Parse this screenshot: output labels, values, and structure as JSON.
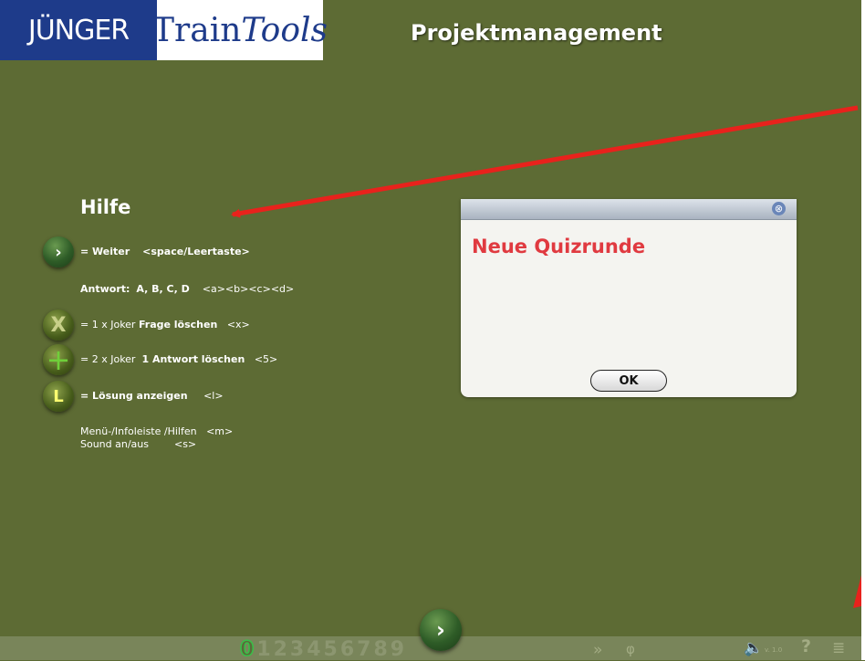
{
  "header": {
    "brand": "JÜNGER",
    "product_train": "Train",
    "product_tools": "Tools",
    "title": "Projektmanagement"
  },
  "help": {
    "title": "Hilfe",
    "next_label": "= Weiter",
    "next_key": "<space/Leertaste>",
    "answer_label": "Antwort:",
    "answer_options": "A, B, C, D",
    "answer_keys": "<a><b><c><d>",
    "joker1_prefix": "= 1 x Joker",
    "joker1_label": "Frage löschen",
    "joker1_key": "<x>",
    "joker2_prefix": "= 2 x Joker",
    "joker2_label": "1 Antwort löschen",
    "joker2_key": "<5>",
    "solution_label": "= Lösung anzeigen",
    "solution_key": "<l>",
    "menu_label": "Menü-/Infoleiste /Hilfen",
    "menu_key": "<m>",
    "sound_label": "Sound an/aus",
    "sound_key": "<s>",
    "icon_x": "X",
    "icon_l": "L"
  },
  "dialog": {
    "heading": "Neue Quizrunde",
    "ok_label": "OK",
    "close_icon": "⊗"
  },
  "bottom": {
    "current_page": "0",
    "pages": "123456789",
    "fast_forward": "»",
    "hint_icon": "φ",
    "version": "v. 1.0",
    "help": "?",
    "menu_icon": "≣"
  },
  "colors": {
    "background": "#5d6b34",
    "brand_blue": "#1e3b8a",
    "dialog_heading": "#e03a40",
    "arrow": "#e8221c"
  }
}
